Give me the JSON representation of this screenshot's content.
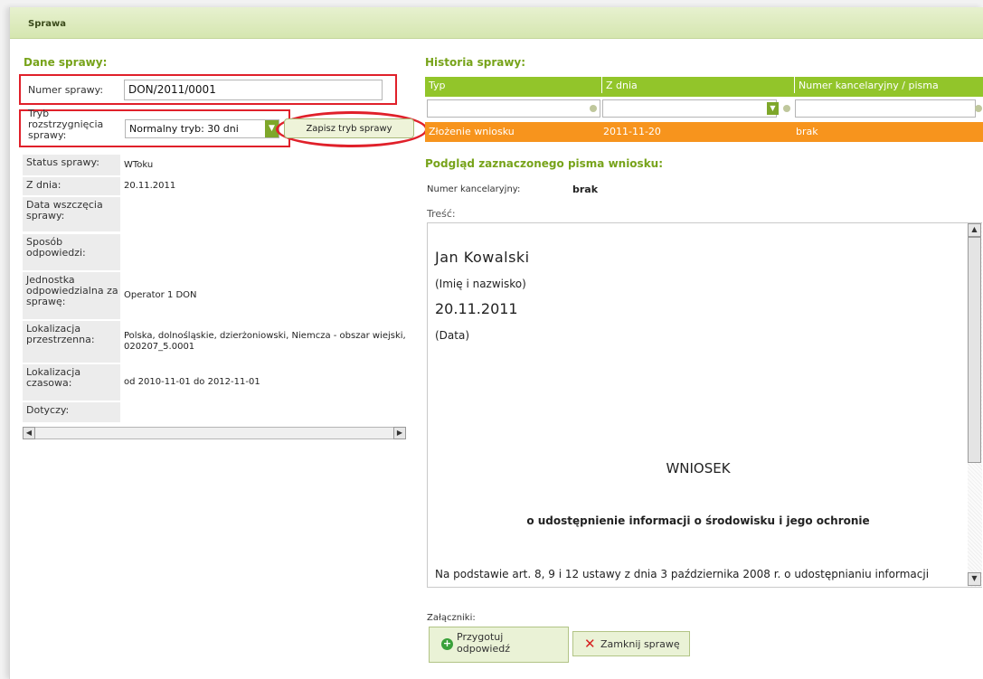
{
  "window": {
    "title": "Sprawa"
  },
  "left": {
    "section_title": "Dane sprawy:",
    "case_number": {
      "label": "Numer sprawy:",
      "value": "DON/2011/0001"
    },
    "mode": {
      "label_line1": "Tryb",
      "label_line2": "rozstrzygnięcia",
      "label_line3": "sprawy:",
      "selected": "Normalny tryb: 30 dni"
    },
    "save_button": "Zapisz tryb sprawy",
    "info": [
      {
        "label": "Status sprawy:",
        "value": "WToku"
      },
      {
        "label": "Z dnia:",
        "value": "20.11.2011"
      },
      {
        "label": "Data wszczęcia sprawy:",
        "value": ""
      },
      {
        "label": "Sposób odpowiedzi:",
        "value": ""
      },
      {
        "label": "Jednostka odpowiedzialna za sprawę:",
        "value": "Operator 1 DON"
      },
      {
        "label": "Lokalizacja przestrzenna:",
        "value": "Polska, dolnośląskie, dzierżoniowski, Niemcza - obszar wiejski, 020207_5.0001"
      },
      {
        "label": "Lokalizacja czasowa:",
        "value": "od 2010-11-01 do 2012-11-01"
      },
      {
        "label": "Dotyczy:",
        "value": ""
      }
    ]
  },
  "right": {
    "history_title": "Historia sprawy:",
    "columns": [
      "Typ",
      "Z dnia",
      "Numer kancelaryjny / pisma"
    ],
    "row": {
      "type": "Złożenie wniosku",
      "date": "2011-11-20",
      "number": "brak"
    },
    "preview_title": "Podgląd zaznaczonego pisma wniosku:",
    "kanc_label": "Numer kancelaryjny:",
    "kanc_value": "brak",
    "content_label": "Treść:",
    "doc": {
      "name": "Jan Kowalski",
      "name_caption": "(Imię i nazwisko)",
      "date": "20.11.2011",
      "date_caption": "(Data)",
      "heading": "WNIOSEK",
      "subheading": "o udostępnienie informacji o środowisku i jego ochronie",
      "body": "Na podstawie art. 8, 9 i 12 ustawy z dnia 3 października 2008 r. o udostępnianiu informacji"
    },
    "attachments_label": "Załączniki:",
    "prepare_button_line1": "Przygotuj",
    "prepare_button_line2": "odpowiedź",
    "close_button": "Zamknij sprawę"
  },
  "colors": {
    "accent_green": "#92c52a",
    "highlight_orange": "#f7941d",
    "annotation_red": "#e0202a"
  }
}
